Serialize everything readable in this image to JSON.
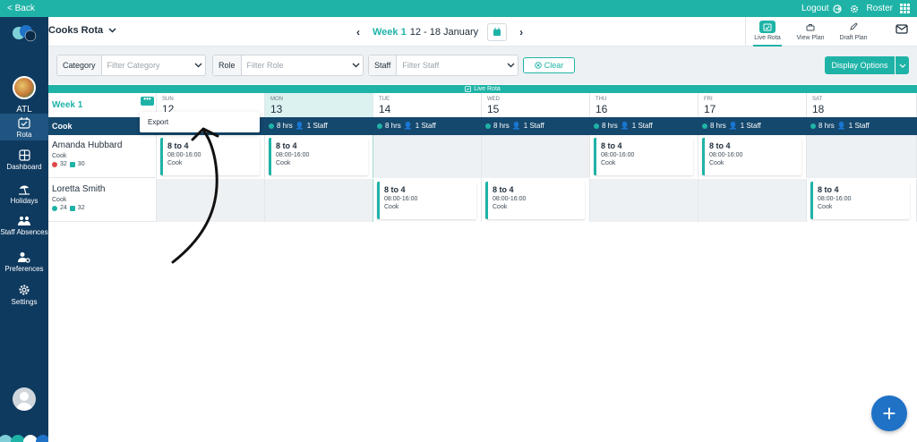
{
  "topbar": {
    "back_label": "< Back",
    "logout_label": "Logout",
    "roster_label": "Roster"
  },
  "sidebar": {
    "site_code": "ATL",
    "items": [
      {
        "label": "Rota",
        "icon": "calendar-check-icon"
      },
      {
        "label": "Dashboard",
        "icon": "dashboard-grid-icon"
      },
      {
        "label": "Holidays",
        "icon": "beach-icon"
      },
      {
        "label": "Staff Absences",
        "icon": "people-icon"
      },
      {
        "label": "Preferences",
        "icon": "person-settings-icon"
      },
      {
        "label": "Settings",
        "icon": "gear-icon"
      }
    ]
  },
  "header": {
    "rota_title": "Cooks Rota",
    "week_label": "Week 1",
    "week_range": "12 - 18 January",
    "views": [
      {
        "label": "Live Rota",
        "icon": "live-rota-icon"
      },
      {
        "label": "View Plan",
        "icon": "briefcase-icon"
      },
      {
        "label": "Draft Plan",
        "icon": "pencil-icon"
      }
    ]
  },
  "filters": {
    "category": {
      "label": "Category",
      "placeholder": "Filter Category"
    },
    "role": {
      "label": "Role",
      "placeholder": "Filter Role"
    },
    "staff": {
      "label": "Staff",
      "placeholder": "Filter Staff"
    },
    "clear_label": "Clear",
    "display_options_label": "Display Options"
  },
  "banner": {
    "label": "Live Rota"
  },
  "grid": {
    "week_label": "Week 1",
    "more_label": "•••",
    "days": [
      {
        "dow": "SUN",
        "num": "12"
      },
      {
        "dow": "MON",
        "num": "13"
      },
      {
        "dow": "TUE",
        "num": "14"
      },
      {
        "dow": "WED",
        "num": "15"
      },
      {
        "dow": "THU",
        "num": "16"
      },
      {
        "dow": "FRI",
        "num": "17"
      },
      {
        "dow": "SAT",
        "num": "18"
      }
    ],
    "category": {
      "name": "Cook",
      "summary_hours": "8 hrs",
      "summary_staff": "1 Staff"
    },
    "staff": [
      {
        "name": "Amanda Hubbard",
        "role": "Cook",
        "stat_a": "32",
        "stat_b": "30",
        "shifts": [
          {
            "title": "8 to 4",
            "hours": "08:00-16:00",
            "role": "Cook"
          },
          {
            "title": "8 to 4",
            "hours": "08:00-16:00",
            "role": "Cook"
          },
          {
            "title": "8 to 4",
            "hours": "08:00-16:00",
            "role": "Cook"
          },
          {
            "title": "8 to 4",
            "hours": "08:00-16:00",
            "role": "Cook"
          }
        ]
      },
      {
        "name": "Loretta Smith",
        "role": "Cook",
        "stat_a": "24",
        "stat_b": "32",
        "shifts": [
          {
            "title": "8 to 4",
            "hours": "08:00-16:00",
            "role": "Cook"
          },
          {
            "title": "8 to 4",
            "hours": "08:00-16:00",
            "role": "Cook"
          },
          {
            "title": "8 to 4",
            "hours": "08:00-16:00",
            "role": "Cook"
          }
        ]
      }
    ]
  },
  "export_menu": {
    "label": "Export"
  },
  "fab": {
    "label": "+"
  },
  "colors": {
    "accent": "#1fb3a7",
    "sidebar": "#0f3a5f",
    "category_bar": "#15486d",
    "fab": "#1f72c6"
  }
}
